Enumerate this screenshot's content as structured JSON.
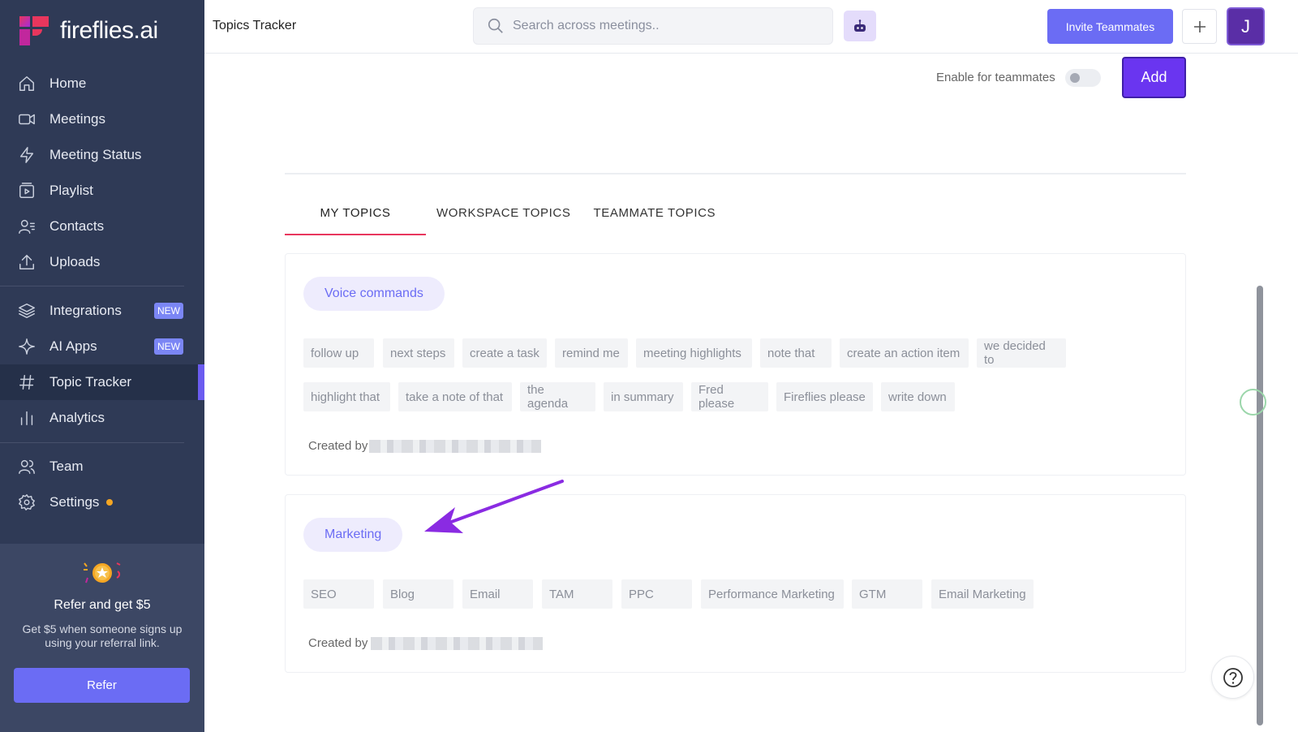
{
  "app": {
    "name": "fireflies.ai",
    "page_title": "Topics Tracker"
  },
  "sidebar": {
    "items": [
      {
        "label": "Home",
        "icon": "home-icon"
      },
      {
        "label": "Meetings",
        "icon": "video-icon"
      },
      {
        "label": "Meeting Status",
        "icon": "bolt-icon"
      },
      {
        "label": "Playlist",
        "icon": "playlist-icon"
      },
      {
        "label": "Contacts",
        "icon": "contacts-icon"
      },
      {
        "label": "Uploads",
        "icon": "upload-icon"
      },
      {
        "label": "Integrations",
        "icon": "layers-icon",
        "badge": "NEW"
      },
      {
        "label": "AI Apps",
        "icon": "sparkle-icon",
        "badge": "NEW"
      },
      {
        "label": "Topic Tracker",
        "icon": "hash-icon",
        "active": true
      },
      {
        "label": "Analytics",
        "icon": "bar-chart-icon"
      },
      {
        "label": "Team",
        "icon": "team-icon"
      },
      {
        "label": "Settings",
        "icon": "gear-icon",
        "dot": true
      }
    ],
    "refer": {
      "title": "Refer and get $5",
      "text": "Get $5 when someone signs up using your referral link.",
      "button": "Refer"
    }
  },
  "topbar": {
    "search_placeholder": "Search across meetings..",
    "invite_label": "Invite Teammates",
    "avatar_initial": "J"
  },
  "controls": {
    "enable_label": "Enable for teammates",
    "enable_on": false,
    "add_label": "Add"
  },
  "tabs": [
    "MY TOPICS",
    "WORKSPACE TOPICS",
    "TEAMMATE TOPICS"
  ],
  "topics": [
    {
      "name": "Voice commands",
      "keywords": [
        "follow up",
        "next steps",
        "create a task",
        "remind me",
        "meeting highlights",
        "note that",
        "create an action item",
        "we decided to",
        "highlight that",
        "take a note of that",
        "the agenda",
        "in summary",
        "Fred please",
        "Fireflies please",
        "write down"
      ],
      "created_by_label": "Created by"
    },
    {
      "name": "Marketing",
      "keywords": [
        "SEO",
        "Blog",
        "Email",
        "TAM",
        "PPC",
        "Performance Marketing",
        "GTM",
        "Email Marketing"
      ],
      "created_by_label": "Created by"
    }
  ],
  "colors": {
    "accent": "#6b6cf4",
    "sidebar": "#2f3a56",
    "tab_underline": "#e8365d",
    "annotation_arrow": "#8a2be2"
  }
}
